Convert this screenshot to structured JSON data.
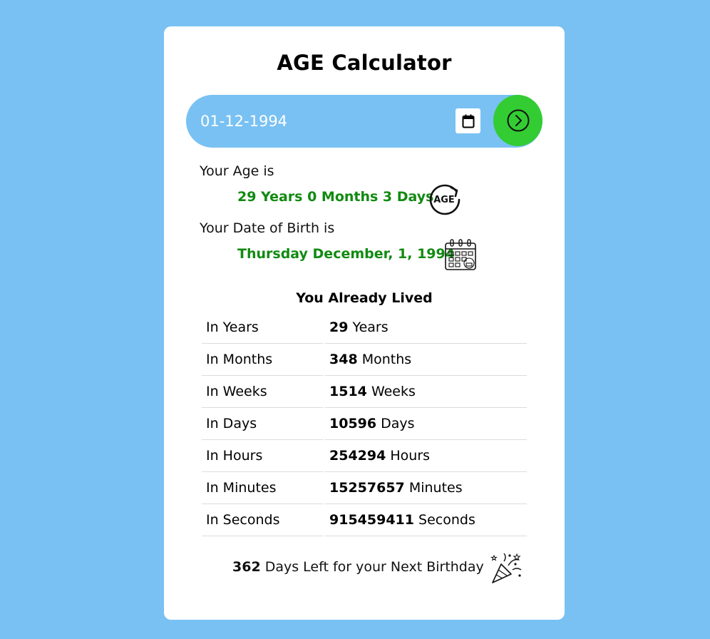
{
  "app": {
    "title": "AGE Calculator"
  },
  "date_input": {
    "value": "01-12-1994"
  },
  "icons": {
    "calendar": "calendar-icon",
    "go": "arrow-right-circle-icon",
    "age": "age-refresh-icon",
    "birthday_calendar": "birthday-calendar-icon",
    "party": "party-popper-icon"
  },
  "age": {
    "label": "Your Age is",
    "value": "29 Years 0 Months 3 Days"
  },
  "dob": {
    "label": "Your Date of Birth is",
    "value": "Thursday December, 1, 1994"
  },
  "lived": {
    "heading": "You Already Lived",
    "rows": [
      {
        "label": "In Years",
        "number": "29",
        "unit": "Years"
      },
      {
        "label": "In Months",
        "number": "348",
        "unit": "Months"
      },
      {
        "label": "In Weeks",
        "number": "1514",
        "unit": "Weeks"
      },
      {
        "label": "In Days",
        "number": "10596",
        "unit": "Days"
      },
      {
        "label": "In Hours",
        "number": "254294",
        "unit": "Hours"
      },
      {
        "label": "In Minutes",
        "number": "15257657",
        "unit": "Minutes"
      },
      {
        "label": "In Seconds",
        "number": "915459411",
        "unit": "Seconds"
      }
    ]
  },
  "next_birthday": {
    "days": "362",
    "text": "Days Left for your Next Birthday"
  },
  "colors": {
    "background": "#79c1f3",
    "accent_green": "#118a11",
    "go_button": "#33cc33"
  }
}
